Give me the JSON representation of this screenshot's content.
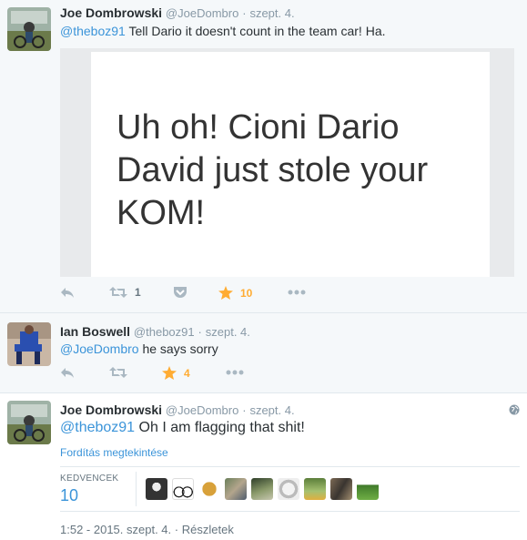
{
  "tweets": [
    {
      "fullname": "Joe Dombrowski",
      "handle": "@JoeDombro",
      "separator": "·",
      "date": "szept. 4.",
      "mention": "@theboz91",
      "body": " Tell Dario it doesn't count in the team car! Ha.",
      "media_lines": [
        "Uh oh! Cioni Dario",
        "David just stole your",
        "KOM!"
      ],
      "retweets": "1",
      "favorites": "10"
    },
    {
      "fullname": "Ian Boswell",
      "handle": "@theboz91",
      "separator": "·",
      "date": "szept. 4.",
      "mention": "@JoeDombro",
      "body": " he says sorry",
      "favorites": "4"
    },
    {
      "fullname": "Joe Dombrowski",
      "handle": "@JoeDombro",
      "separator": "·",
      "date": "szept. 4.",
      "mention": "@theboz91",
      "body": " Oh I am flagging that shit!",
      "translate": "Fordítás megtekintése",
      "favorites_label": "KEDVENCEK",
      "favorites": "10",
      "timestamp": "1:52 - 2015. szept. 4.",
      "details": "Részletek"
    }
  ],
  "colors": {
    "link": "#3b94d9",
    "favorite": "#ffac33",
    "muted": "#8899a6"
  },
  "icons": [
    "reply-icon",
    "retweet-icon",
    "pocket-icon",
    "star-icon",
    "more-icon",
    "globe-icon"
  ]
}
